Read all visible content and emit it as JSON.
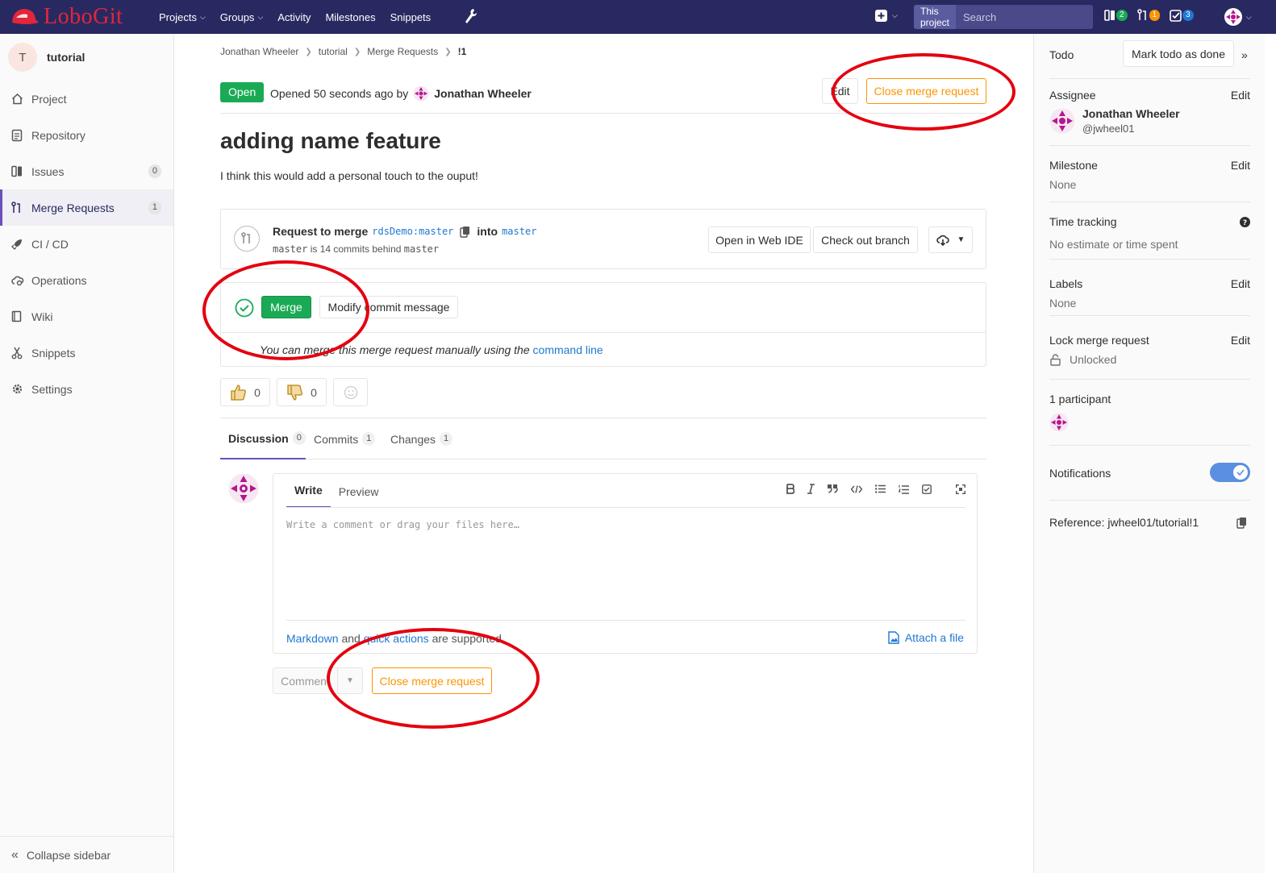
{
  "topnav": {
    "logo_text": "LoboGit",
    "links": [
      "Projects",
      "Groups",
      "Activity",
      "Milestones",
      "Snippets"
    ],
    "search_scope": "This project",
    "search_placeholder": "Search",
    "counters": {
      "issues": "2",
      "merge_requests": "1",
      "todos": "3"
    },
    "colors": {
      "bar": "#292961",
      "issues_badge": "#1aaa55",
      "mr_badge": "#fc9403",
      "todo_badge": "#1f78d1"
    }
  },
  "sidebar": {
    "project_initial": "T",
    "project_name": "tutorial",
    "items": [
      {
        "label": "Project",
        "icon": "home-icon"
      },
      {
        "label": "Repository",
        "icon": "doc-icon"
      },
      {
        "label": "Issues",
        "icon": "issues-icon",
        "count": "0"
      },
      {
        "label": "Merge Requests",
        "icon": "merge-request-icon",
        "count": "1"
      },
      {
        "label": "CI / CD",
        "icon": "rocket-icon"
      },
      {
        "label": "Operations",
        "icon": "cloud-gear-icon"
      },
      {
        "label": "Wiki",
        "icon": "book-icon"
      },
      {
        "label": "Snippets",
        "icon": "scissors-icon"
      },
      {
        "label": "Settings",
        "icon": "gear-icon"
      }
    ],
    "collapse_label": "Collapse sidebar"
  },
  "breadcrumb": [
    "Jonathan Wheeler",
    "tutorial",
    "Merge Requests",
    "!1"
  ],
  "mr": {
    "status": "Open",
    "opened_text": "Opened 50 seconds ago by",
    "author": "Jonathan Wheeler",
    "edit_label": "Edit",
    "close_label": "Close merge request",
    "title": "adding name feature",
    "description": "I think this would add a personal touch to the ouput!"
  },
  "widget": {
    "request_to_merge": "Request to merge",
    "source_repo": "rdsDemo",
    "source_branch": "master",
    "into": "into",
    "target_branch": "master",
    "behind_branch": "master",
    "behind_text": "is 14 commits behind",
    "behind_target": "master",
    "open_web_ide": "Open in Web IDE",
    "check_out_branch": "Check out branch",
    "merge_label": "Merge",
    "modify_commit": "Modify commit message",
    "manual_text": "You can merge this merge request manually using the",
    "command_line": "command line"
  },
  "awards": {
    "thumbs_up": "0",
    "thumbs_down": "0"
  },
  "tabs": [
    {
      "label": "Discussion",
      "count": "0"
    },
    {
      "label": "Commits",
      "count": "1"
    },
    {
      "label": "Changes",
      "count": "1"
    }
  ],
  "editor": {
    "write_tab": "Write",
    "preview_tab": "Preview",
    "placeholder": "Write a comment or drag your files here…",
    "markdown_link": "Markdown",
    "and_text": "and",
    "quick_actions_link": "quick actions",
    "supported_text": "are supported",
    "attach_label": "Attach a file"
  },
  "comment_actions": {
    "comment_label": "Comment",
    "close_label": "Close merge request"
  },
  "rightbar": {
    "todo_label": "Todo",
    "mark_done_label": "Mark todo as done",
    "assignee_title": "Assignee",
    "assignee_name": "Jonathan Wheeler",
    "assignee_username": "@jwheel01",
    "milestone_title": "Milestone",
    "milestone_value": "None",
    "time_tracking_title": "Time tracking",
    "time_tracking_value": "No estimate or time spent",
    "labels_title": "Labels",
    "labels_value": "None",
    "lock_title": "Lock merge request",
    "lock_value": "Unlocked",
    "participants_title": "1 participant",
    "notifications_title": "Notifications",
    "reference_text": "Reference: jwheel01/tutorial!1",
    "edit_label": "Edit"
  },
  "annotation_color": "#e4000f"
}
